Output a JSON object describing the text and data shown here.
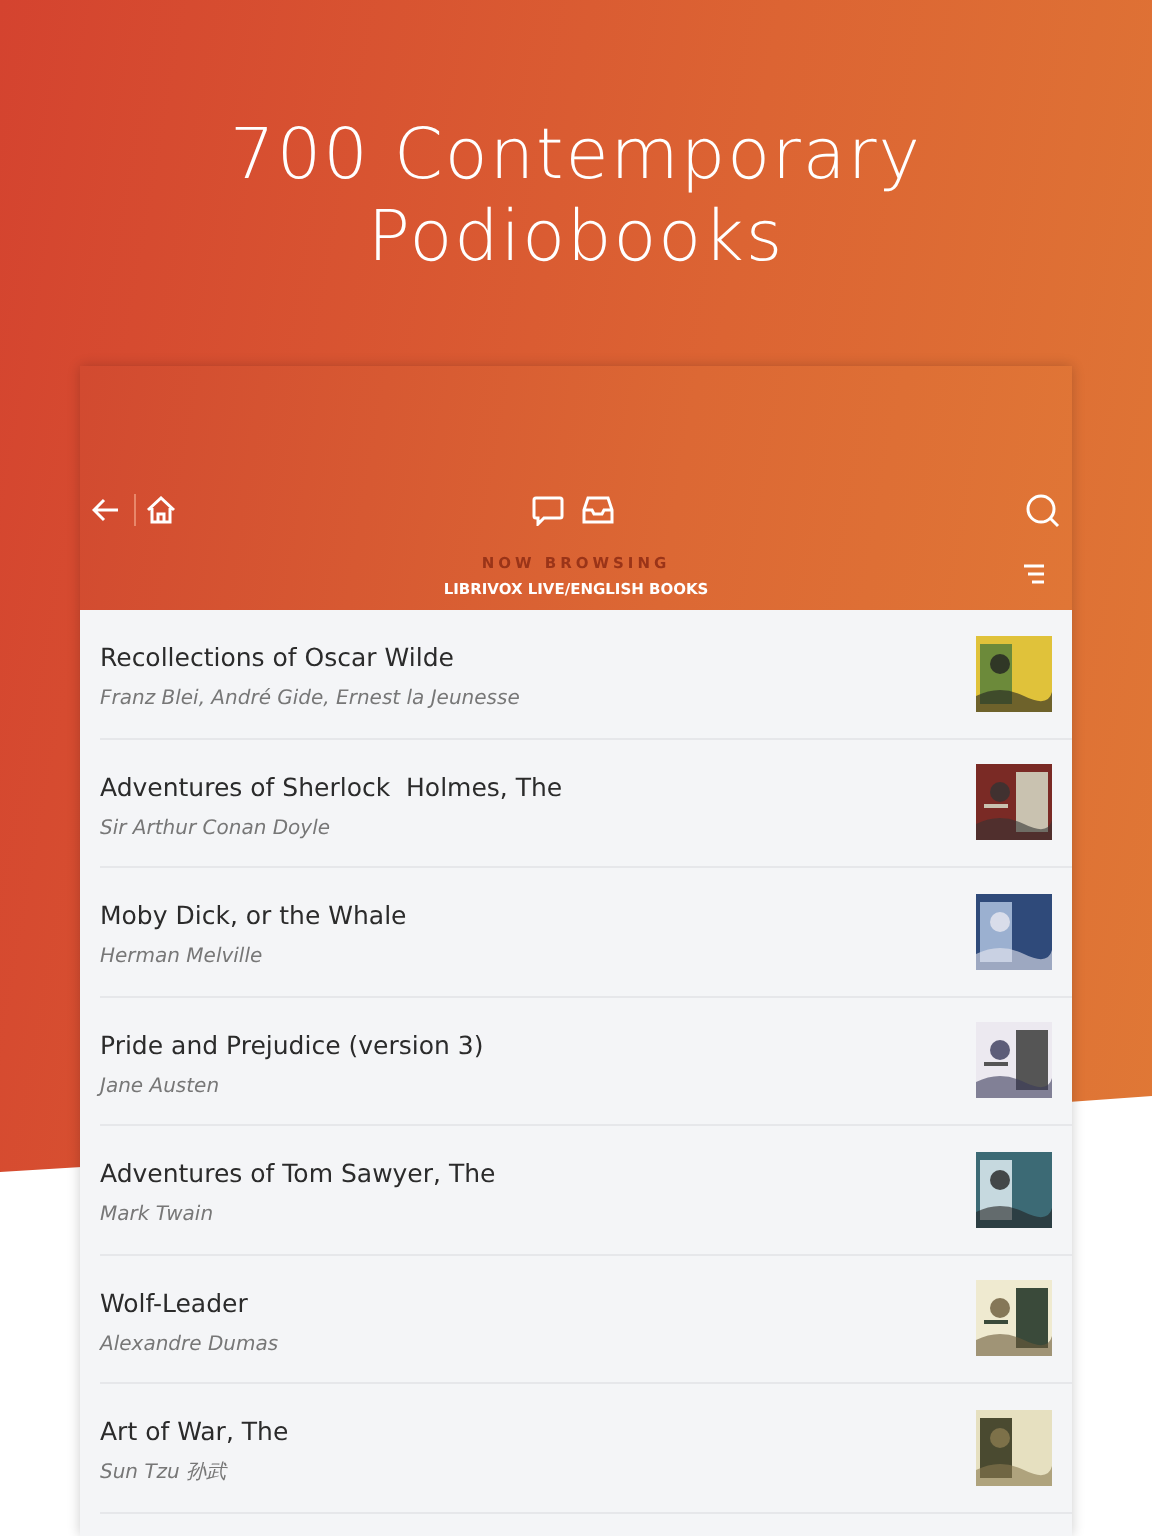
{
  "headline": {
    "lines": [
      "700 Contemporary",
      "Podiobooks"
    ]
  },
  "toolbar": {
    "browsing_label": "NOW BROWSING",
    "collection": "LIBRIVOX LIVE/ENGLISH BOOKS"
  },
  "books": [
    {
      "title": "Recollections of Oscar Wilde",
      "author": "Franz Blei, André Gide, Ernest la Jeunesse"
    },
    {
      "title": "Adventures of Sherlock  Holmes, The",
      "author": "Sir Arthur Conan Doyle"
    },
    {
      "title": "Moby Dick, or the Whale",
      "author": "Herman Melville"
    },
    {
      "title": "Pride and Prejudice (version 3)",
      "author": "Jane Austen"
    },
    {
      "title": "Adventures of Tom Sawyer, The",
      "author": "Mark Twain"
    },
    {
      "title": "Wolf-Leader",
      "author": "Alexandre Dumas"
    },
    {
      "title": "Art of War, The",
      "author": "Sun Tzu 孙武"
    }
  ]
}
